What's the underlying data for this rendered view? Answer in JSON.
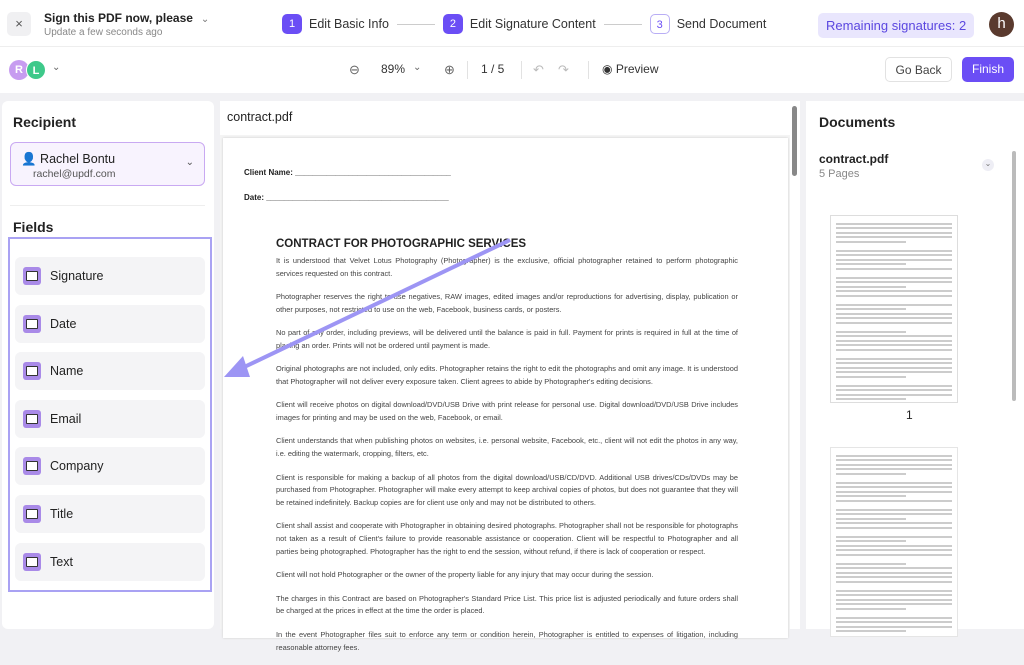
{
  "header": {
    "close": "×",
    "title": "Sign this PDF now, please",
    "subtitle": "Update a few seconds ago",
    "steps": [
      {
        "num": "1",
        "label": "Edit Basic Info"
      },
      {
        "num": "2",
        "label": "Edit Signature Content"
      },
      {
        "num": "3",
        "label": "Send Document"
      }
    ],
    "remaining": "Remaining signatures: 2",
    "avatar": "h"
  },
  "toolbar": {
    "avatars": [
      "R",
      "L"
    ],
    "zoom": "89%",
    "page": "1 / 5",
    "preview": "Preview",
    "go_back": "Go Back",
    "finish": "Finish"
  },
  "left": {
    "recipient_heading": "Recipient",
    "recipient_name": "Rachel Bontu",
    "recipient_email": "rachel@updf.com",
    "fields_heading": "Fields",
    "fields": [
      {
        "label": "Signature"
      },
      {
        "label": "Date"
      },
      {
        "label": "Name"
      },
      {
        "label": "Email"
      },
      {
        "label": "Company"
      },
      {
        "label": "Title"
      },
      {
        "label": "Text"
      }
    ]
  },
  "doc": {
    "file": "contract.pdf",
    "client_name": "Client Name: ___________________________________",
    "date": "Date: _________________________________________",
    "title": "CONTRACT FOR PHOTOGRAPHIC SERVICES",
    "paragraphs": [
      "It is understood that Velvet Lotus Photography (Photographer) is the exclusive, official photographer retained to perform photographic services requested on this contract.",
      "Photographer reserves the right to use negatives, RAW images, edited images and/or reproductions for advertising, display, publication or other purposes, not restricted to use on the web, Facebook, business cards, or posters.",
      "No part of any order, including previews, will be delivered until the balance is paid in full. Payment for prints is required in full at the time of placing an order. Prints will not be ordered until payment is made.",
      "Original photographs are not included, only edits. Photographer retains the right to edit the photographs and omit any image. It is understood that Photographer will not deliver every exposure taken. Client agrees to abide by Photographer's editing decisions.",
      "Client will receive photos on digital download/DVD/USB Drive with print release for personal use. Digital download/DVD/USB Drive includes images for printing and may be used on the web, Facebook, or email.",
      "Client understands that when publishing photos on websites, i.e. personal website, Facebook, etc., client will not edit the photos in any way, i.e. editing the watermark, cropping, filters, etc.",
      "Client is responsible for making a backup of all photos from the digital download/USB/CD/DVD. Additional USB drives/CDs/DVDs may be purchased from Photographer. Photographer will make every attempt to keep archival copies of photos, but does not guarantee that they will be retained indefinitely. Backup copies are for client use only and may not be distributed to others.",
      "Client shall assist and cooperate with Photographer in obtaining desired photographs. Photographer shall not be responsible for photographs not taken as a result of Client's failure to provide reasonable assistance or cooperation. Client will be respectful to Photographer and all parties being photographed. Photographer has the right to end the session, without refund, if there is lack of cooperation or respect.",
      "Client will not hold Photographer or the owner of the property liable for any injury that may occur during the session.",
      "The charges in this Contract are based on Photographer's Standard Price List. This price list is adjusted periodically and future orders shall be charged at the prices in effect at the time the order is placed.",
      "In the event Photographer files suit to enforce any term or condition herein, Photographer is entitled to expenses of litigation, including reasonable attorney fees."
    ]
  },
  "right": {
    "heading": "Documents",
    "file": "contract.pdf",
    "pages": "5 Pages",
    "thumb_label": "1"
  }
}
